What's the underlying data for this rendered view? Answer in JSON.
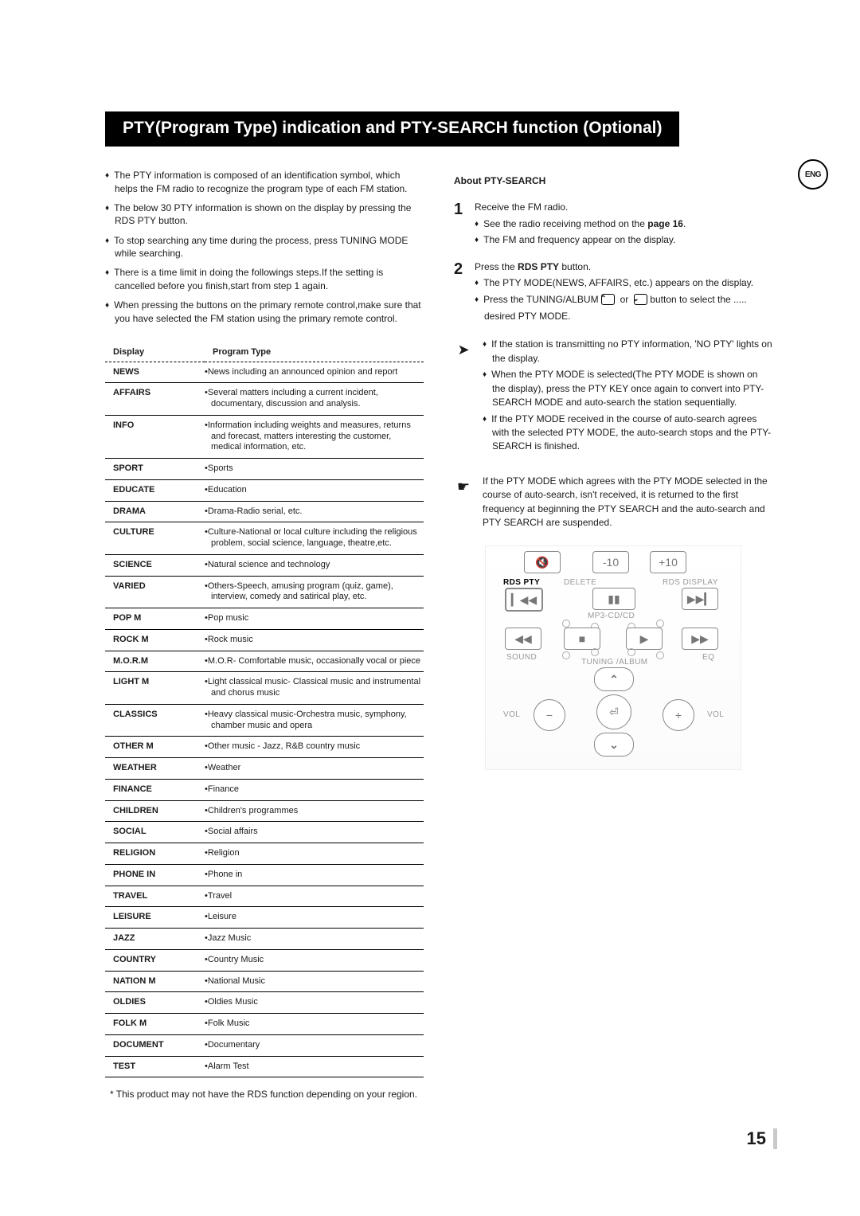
{
  "lang_badge": "ENG",
  "title": "PTY(Program Type) indication and PTY-SEARCH function (Optional)",
  "intro": [
    "The PTY information is composed of an identification symbol, which helps the FM radio to recognize the program type of each FM station.",
    "The below 30 PTY information is shown on the display by pressing the RDS PTY button.",
    "To stop searching any time during the process, press TUNING MODE while searching.",
    "There is a time limit in doing the followings steps.If the setting is cancelled before you finish,start from step 1 again.",
    "When pressing the buttons on the primary remote control,make sure that you have selected the FM station using the primary remote control."
  ],
  "table": {
    "head_display": "Display",
    "head_type": "Program Type",
    "rows": [
      {
        "k": "NEWS",
        "v": "News including an announced opinion and report"
      },
      {
        "k": "AFFAIRS",
        "v": "Several matters including a current incident, documentary, discussion and analysis."
      },
      {
        "k": "INFO",
        "v": "Information including weights and measures, returns and forecast, matters interesting the customer, medical information, etc."
      },
      {
        "k": "SPORT",
        "v": "Sports"
      },
      {
        "k": "EDUCATE",
        "v": "Education"
      },
      {
        "k": "DRAMA",
        "v": "Drama-Radio serial, etc."
      },
      {
        "k": "CULTURE",
        "v": "Culture-National or local culture including the religious problem, social science, language, theatre,etc."
      },
      {
        "k": "SCIENCE",
        "v": "Natural science and technology"
      },
      {
        "k": "VARIED",
        "v": "Others-Speech, amusing program (quiz, game), interview, comedy and satirical play, etc."
      },
      {
        "k": "POP M",
        "v": "Pop music"
      },
      {
        "k": "ROCK M",
        "v": "Rock music"
      },
      {
        "k": "M.O.R.M",
        "v": "M.O.R- Comfortable music, occasionally vocal or piece"
      },
      {
        "k": "LIGHT M",
        "v": "Light classical music- Classical music and instrumental and chorus music"
      },
      {
        "k": "CLASSICS",
        "v": "Heavy classical  music-Orchestra music, symphony, chamber music and opera"
      },
      {
        "k": "OTHER M",
        "v": "Other music - Jazz, R&B country music"
      },
      {
        "k": "WEATHER",
        "v": "Weather"
      },
      {
        "k": "FINANCE",
        "v": "Finance"
      },
      {
        "k": "CHILDREN",
        "v": "Children's programmes"
      },
      {
        "k": "SOCIAL",
        "v": "Social affairs"
      },
      {
        "k": "RELIGION",
        "v": "Religion"
      },
      {
        "k": "PHONE IN",
        "v": "Phone in"
      },
      {
        "k": "TRAVEL",
        "v": "Travel"
      },
      {
        "k": "LEISURE",
        "v": "Leisure"
      },
      {
        "k": "JAZZ",
        "v": "Jazz Music"
      },
      {
        "k": "COUNTRY",
        "v": "Country Music"
      },
      {
        "k": "NATION M",
        "v": "National Music"
      },
      {
        "k": "OLDIES",
        "v": "Oldies Music"
      },
      {
        "k": "FOLK M",
        "v": "Folk Music"
      },
      {
        "k": "DOCUMENT",
        "v": "Documentary"
      },
      {
        "k": "TEST",
        "v": "Alarm Test"
      }
    ]
  },
  "about_head": "About PTY-SEARCH",
  "steps": [
    {
      "num": "1",
      "lead": "Receive the FM radio.",
      "subs": [
        {
          "t": "See the radio receiving method on the ",
          "b": "page 16",
          "a": "."
        },
        {
          "t": "The FM and frequency appear on the display."
        }
      ]
    },
    {
      "num": "2",
      "lead_before": "Press the ",
      "lead_bold": "RDS PTY",
      "lead_after": " button.",
      "subs": [
        {
          "t": "The PTY MODE(NEWS, AFFAIRS, etc.) appears on the display."
        },
        {
          "t": "Press the TUNING/ALBUM ",
          "ic": true,
          "a": " button to select the  ....."
        }
      ],
      "tail": "desired PTY MODE."
    }
  ],
  "note1_items": [
    "If the station is transmitting no PTY information, 'NO PTY' lights on the display.",
    "When the PTY MODE is selected(The PTY MODE is shown on the display), press the PTY KEY once again to convert into PTY-SEARCH MODE and auto-search the station sequentially.",
    "If the PTY MODE received in the course of auto-search agrees with the selected PTY MODE, the auto-search stops and the PTY-SEARCH is finished."
  ],
  "note2": "If the PTY MODE which agrees with the PTY MODE selected in the course of auto-search, isn't received, it is returned to the first frequency at beginning the PTY SEARCH and the auto-search and PTY SEARCH are suspended.",
  "remote": {
    "minus10": "-10",
    "plus10": "+10",
    "rdspty": "RDS PTY",
    "delete": "DELETE",
    "rdsdisplay": "RDS DISPLAY",
    "mp3": "MP3-CD/CD",
    "tuning": "TUNING /ALBUM",
    "sound": "SOUND",
    "eq": "EQ",
    "vol": "VOL"
  },
  "footnote": "* This product may not have the RDS function depending on your region.",
  "page_number": "15"
}
